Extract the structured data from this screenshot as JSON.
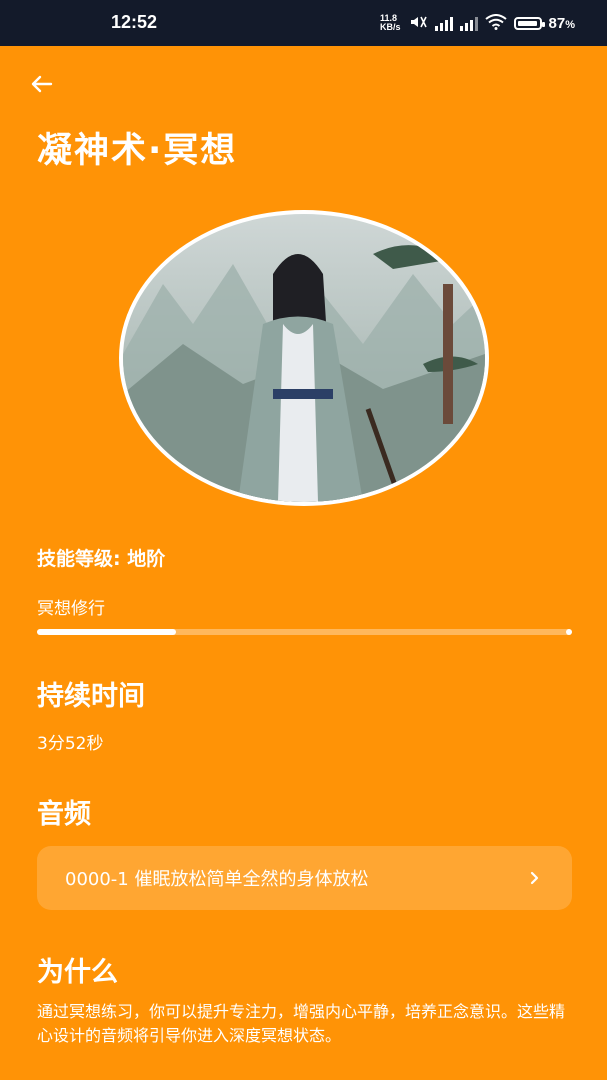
{
  "status_bar": {
    "time": "12:52",
    "net_speed_value": "11.8",
    "net_speed_unit": "KB/s",
    "battery_percent": "87",
    "battery_suffix": "%"
  },
  "header": {
    "back_icon": "back-arrow-icon",
    "title": "凝神术·冥想"
  },
  "skill": {
    "level_text": "技能等级: 地阶",
    "progress_label": "冥想修行",
    "progress_fraction": 0.26
  },
  "duration": {
    "heading": "持续时间",
    "value": "3分52秒"
  },
  "audio": {
    "heading": "音频",
    "track_name": "0000-1 催眠放松简单全然的身体放松",
    "chevron_icon": "chevron-right-icon"
  },
  "why": {
    "heading": "为什么",
    "description": "通过冥想练习，你可以提升专注力，增强内心平静，培养正念意识。这些精心设计的音频将引导你进入深度冥想状态。"
  },
  "colors": {
    "background": "#FF9306",
    "status_bar": "#131A2A",
    "text": "#FFFFFF"
  }
}
